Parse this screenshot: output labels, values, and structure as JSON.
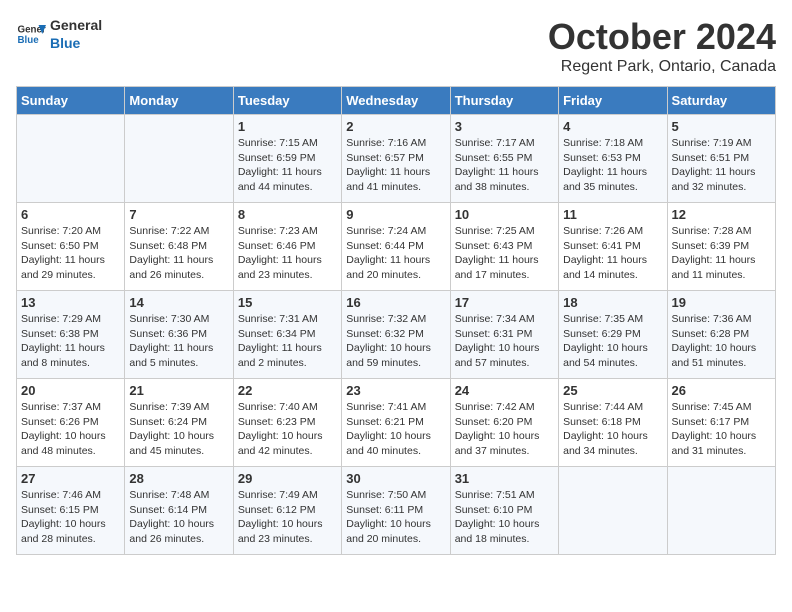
{
  "logo": {
    "line1": "General",
    "line2": "Blue"
  },
  "title": "October 2024",
  "subtitle": "Regent Park, Ontario, Canada",
  "days_header": [
    "Sunday",
    "Monday",
    "Tuesday",
    "Wednesday",
    "Thursday",
    "Friday",
    "Saturday"
  ],
  "weeks": [
    [
      {
        "day": "",
        "detail": ""
      },
      {
        "day": "",
        "detail": ""
      },
      {
        "day": "1",
        "detail": "Sunrise: 7:15 AM\nSunset: 6:59 PM\nDaylight: 11 hours\nand 44 minutes."
      },
      {
        "day": "2",
        "detail": "Sunrise: 7:16 AM\nSunset: 6:57 PM\nDaylight: 11 hours\nand 41 minutes."
      },
      {
        "day": "3",
        "detail": "Sunrise: 7:17 AM\nSunset: 6:55 PM\nDaylight: 11 hours\nand 38 minutes."
      },
      {
        "day": "4",
        "detail": "Sunrise: 7:18 AM\nSunset: 6:53 PM\nDaylight: 11 hours\nand 35 minutes."
      },
      {
        "day": "5",
        "detail": "Sunrise: 7:19 AM\nSunset: 6:51 PM\nDaylight: 11 hours\nand 32 minutes."
      }
    ],
    [
      {
        "day": "6",
        "detail": "Sunrise: 7:20 AM\nSunset: 6:50 PM\nDaylight: 11 hours\nand 29 minutes."
      },
      {
        "day": "7",
        "detail": "Sunrise: 7:22 AM\nSunset: 6:48 PM\nDaylight: 11 hours\nand 26 minutes."
      },
      {
        "day": "8",
        "detail": "Sunrise: 7:23 AM\nSunset: 6:46 PM\nDaylight: 11 hours\nand 23 minutes."
      },
      {
        "day": "9",
        "detail": "Sunrise: 7:24 AM\nSunset: 6:44 PM\nDaylight: 11 hours\nand 20 minutes."
      },
      {
        "day": "10",
        "detail": "Sunrise: 7:25 AM\nSunset: 6:43 PM\nDaylight: 11 hours\nand 17 minutes."
      },
      {
        "day": "11",
        "detail": "Sunrise: 7:26 AM\nSunset: 6:41 PM\nDaylight: 11 hours\nand 14 minutes."
      },
      {
        "day": "12",
        "detail": "Sunrise: 7:28 AM\nSunset: 6:39 PM\nDaylight: 11 hours\nand 11 minutes."
      }
    ],
    [
      {
        "day": "13",
        "detail": "Sunrise: 7:29 AM\nSunset: 6:38 PM\nDaylight: 11 hours\nand 8 minutes."
      },
      {
        "day": "14",
        "detail": "Sunrise: 7:30 AM\nSunset: 6:36 PM\nDaylight: 11 hours\nand 5 minutes."
      },
      {
        "day": "15",
        "detail": "Sunrise: 7:31 AM\nSunset: 6:34 PM\nDaylight: 11 hours\nand 2 minutes."
      },
      {
        "day": "16",
        "detail": "Sunrise: 7:32 AM\nSunset: 6:32 PM\nDaylight: 10 hours\nand 59 minutes."
      },
      {
        "day": "17",
        "detail": "Sunrise: 7:34 AM\nSunset: 6:31 PM\nDaylight: 10 hours\nand 57 minutes."
      },
      {
        "day": "18",
        "detail": "Sunrise: 7:35 AM\nSunset: 6:29 PM\nDaylight: 10 hours\nand 54 minutes."
      },
      {
        "day": "19",
        "detail": "Sunrise: 7:36 AM\nSunset: 6:28 PM\nDaylight: 10 hours\nand 51 minutes."
      }
    ],
    [
      {
        "day": "20",
        "detail": "Sunrise: 7:37 AM\nSunset: 6:26 PM\nDaylight: 10 hours\nand 48 minutes."
      },
      {
        "day": "21",
        "detail": "Sunrise: 7:39 AM\nSunset: 6:24 PM\nDaylight: 10 hours\nand 45 minutes."
      },
      {
        "day": "22",
        "detail": "Sunrise: 7:40 AM\nSunset: 6:23 PM\nDaylight: 10 hours\nand 42 minutes."
      },
      {
        "day": "23",
        "detail": "Sunrise: 7:41 AM\nSunset: 6:21 PM\nDaylight: 10 hours\nand 40 minutes."
      },
      {
        "day": "24",
        "detail": "Sunrise: 7:42 AM\nSunset: 6:20 PM\nDaylight: 10 hours\nand 37 minutes."
      },
      {
        "day": "25",
        "detail": "Sunrise: 7:44 AM\nSunset: 6:18 PM\nDaylight: 10 hours\nand 34 minutes."
      },
      {
        "day": "26",
        "detail": "Sunrise: 7:45 AM\nSunset: 6:17 PM\nDaylight: 10 hours\nand 31 minutes."
      }
    ],
    [
      {
        "day": "27",
        "detail": "Sunrise: 7:46 AM\nSunset: 6:15 PM\nDaylight: 10 hours\nand 28 minutes."
      },
      {
        "day": "28",
        "detail": "Sunrise: 7:48 AM\nSunset: 6:14 PM\nDaylight: 10 hours\nand 26 minutes."
      },
      {
        "day": "29",
        "detail": "Sunrise: 7:49 AM\nSunset: 6:12 PM\nDaylight: 10 hours\nand 23 minutes."
      },
      {
        "day": "30",
        "detail": "Sunrise: 7:50 AM\nSunset: 6:11 PM\nDaylight: 10 hours\nand 20 minutes."
      },
      {
        "day": "31",
        "detail": "Sunrise: 7:51 AM\nSunset: 6:10 PM\nDaylight: 10 hours\nand 18 minutes."
      },
      {
        "day": "",
        "detail": ""
      },
      {
        "day": "",
        "detail": ""
      }
    ]
  ]
}
